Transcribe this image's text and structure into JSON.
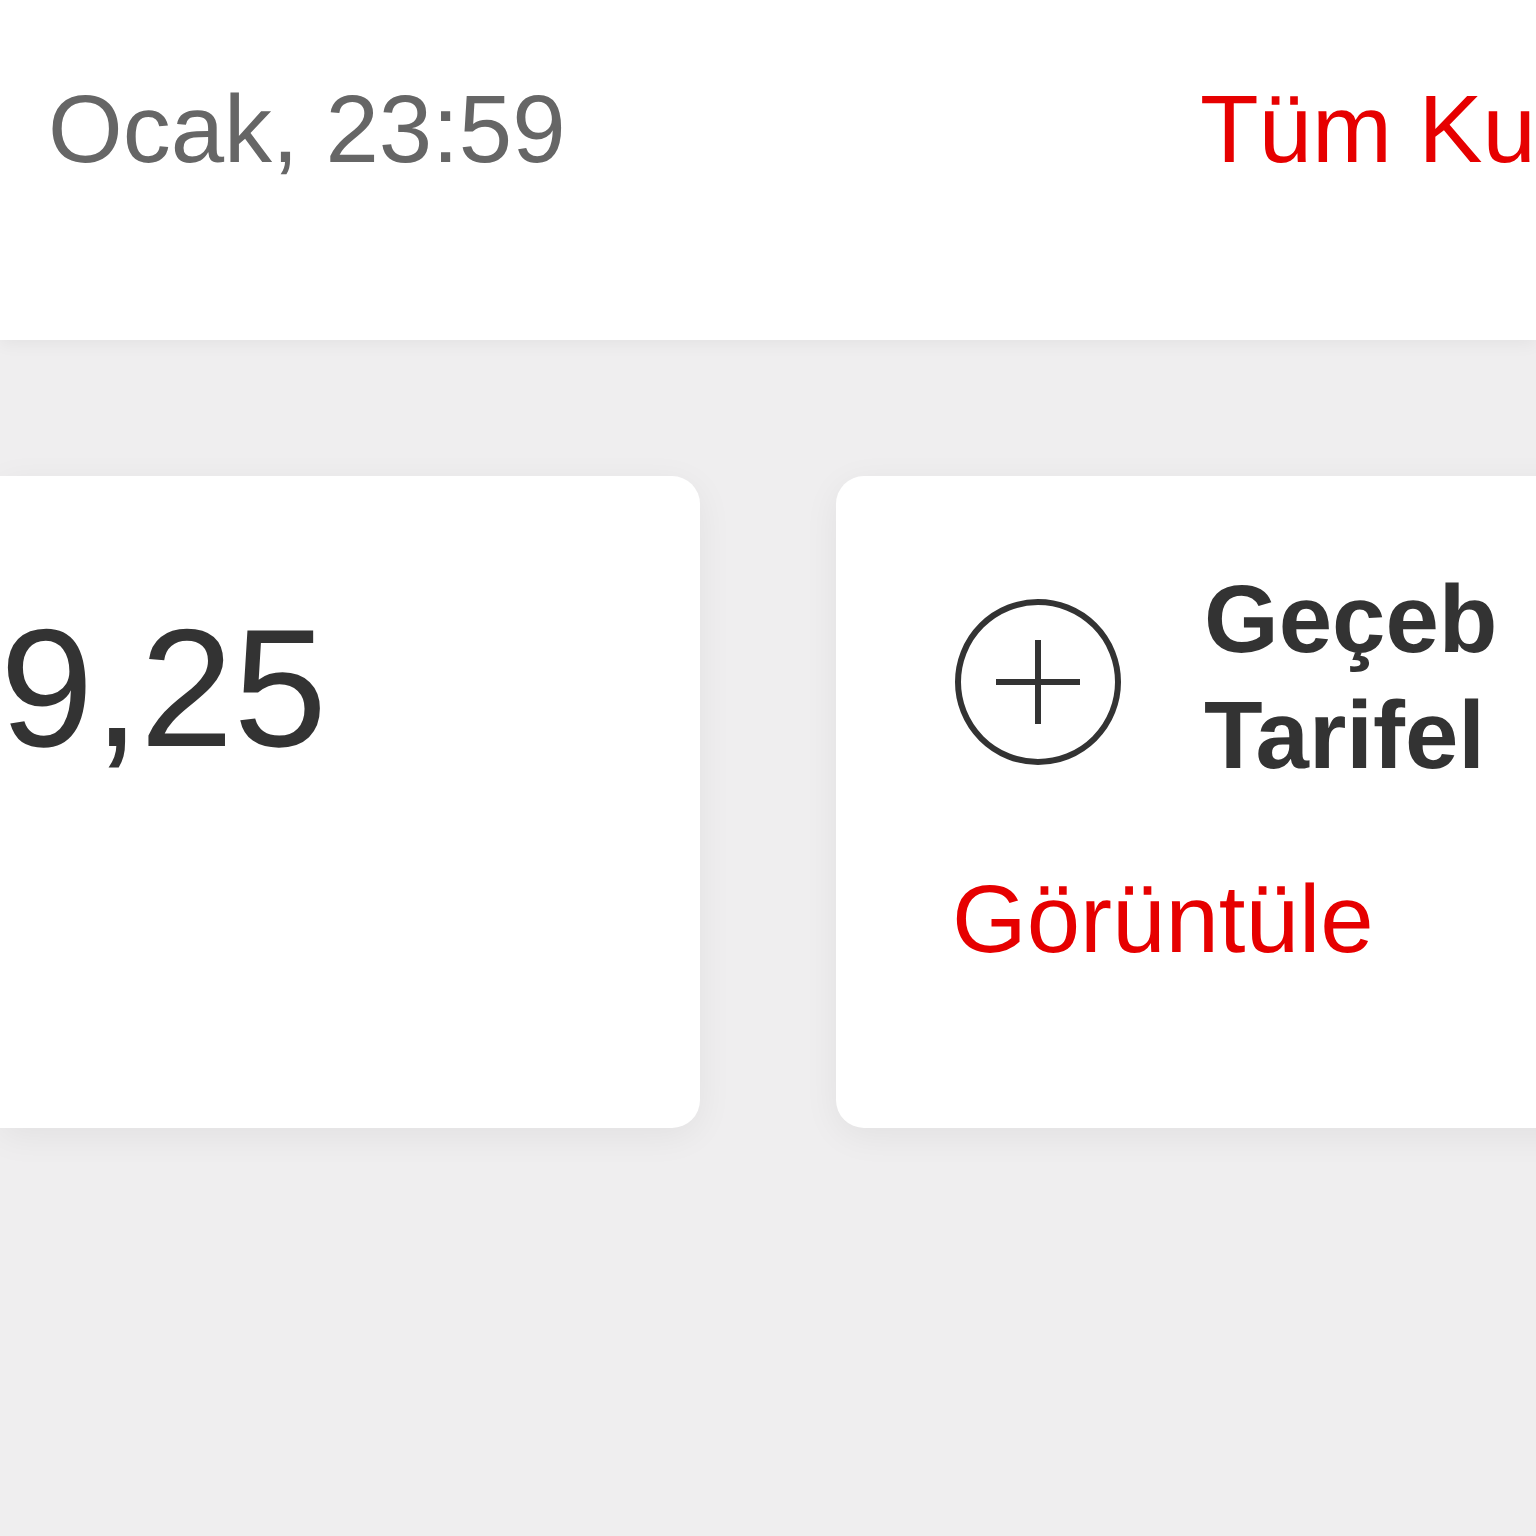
{
  "header": {
    "date": "Ocak, 23:59",
    "link": "Tüm Ku"
  },
  "cards": [
    {
      "kind": "amount",
      "value": "9,25"
    },
    {
      "kind": "action",
      "title_lines": [
        "Geçeb",
        "Tarifel"
      ],
      "link": "Görüntüle"
    }
  ]
}
